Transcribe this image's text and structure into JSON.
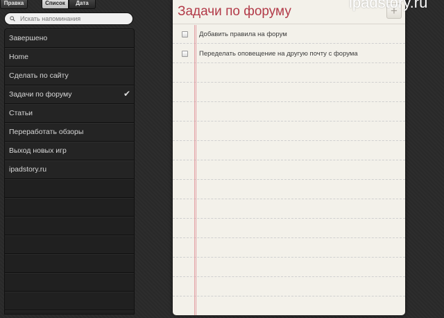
{
  "toolbar": {
    "edit_label": "Правка",
    "segments": [
      "Список",
      "Дата"
    ],
    "selected_segment": "Список"
  },
  "search": {
    "placeholder": "Искать напоминания",
    "value": "",
    "icon": "search-icon"
  },
  "sidebar": {
    "items": [
      {
        "label": "Завершено",
        "selected": false
      },
      {
        "label": "Home",
        "selected": false
      },
      {
        "label": "Сделать по сайту",
        "selected": false
      },
      {
        "label": "Задачи по форуму",
        "selected": true
      },
      {
        "label": "Статьи",
        "selected": false
      },
      {
        "label": "Переработать обзоры",
        "selected": false
      },
      {
        "label": "Выход новых игр",
        "selected": false
      },
      {
        "label": "ipadstory.ru",
        "selected": false
      }
    ],
    "check_glyph": "✔"
  },
  "main": {
    "title": "Задачи по форуму",
    "add_glyph": "+",
    "tasks": [
      {
        "text": "Добавить правила на форум",
        "done": false
      },
      {
        "text": "Переделать оповещение на другую почту с форума",
        "done": false
      }
    ]
  },
  "watermark": "ipadstory.ru",
  "colors": {
    "background": "#2a2a2a",
    "paper": "#f3f1ea",
    "title": "#b23a48",
    "margin_line": "#e3a0a5"
  }
}
